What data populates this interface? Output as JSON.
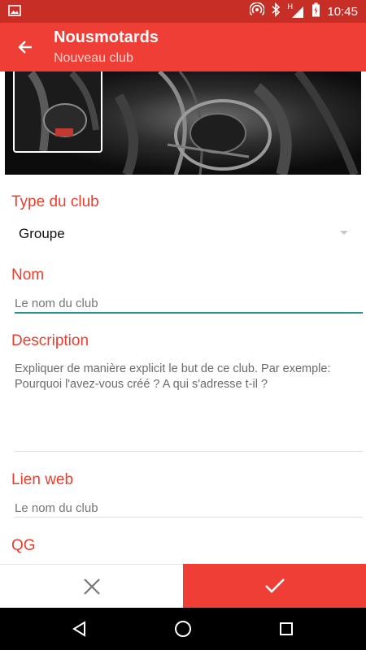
{
  "status_bar": {
    "time": "10:45",
    "icons": [
      "image-icon",
      "hotspot-icon",
      "bluetooth-icon",
      "signal-icon",
      "battery-icon"
    ],
    "network_label": "H"
  },
  "app_bar": {
    "title": "Nousmotards",
    "subtitle": "Nouveau club",
    "back_icon": "arrow-back-icon",
    "color": "#ee3e36"
  },
  "form": {
    "type_label": "Type du club",
    "type_value": "Groupe",
    "name_label": "Nom",
    "name_placeholder": "Le nom du club",
    "description_label": "Description",
    "description_placeholder": "Expliquer de manière explicit le but de ce club. Par exemple: Pourquoi l'avez-vous créé ? A qui s'adresse t-il ?",
    "web_label": "Lien web",
    "web_placeholder": "Le nom du club",
    "hq_label": "QG"
  },
  "actions": {
    "cancel_icon": "close-icon",
    "confirm_icon": "check-icon"
  },
  "nav": {
    "icons": [
      "back-triangle-icon",
      "home-circle-icon",
      "recents-square-icon"
    ]
  },
  "colors": {
    "accent": "#ee3e36",
    "status": "#c72f26",
    "label": "#e8402f",
    "focus": "#26968a"
  }
}
